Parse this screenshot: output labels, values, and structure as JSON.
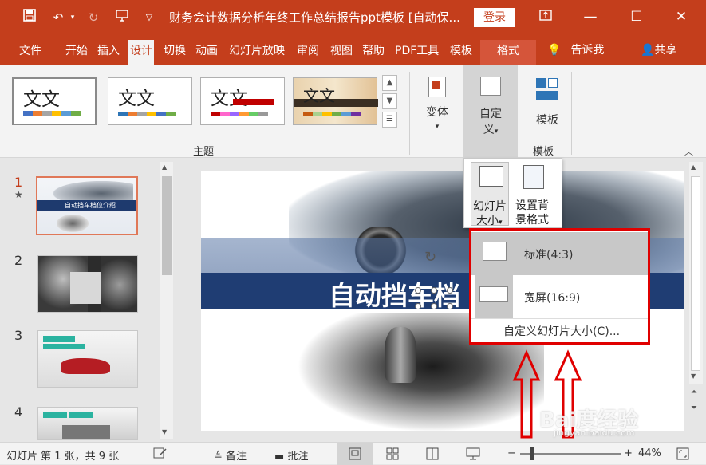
{
  "window": {
    "title": "财务会计数据分析年终工作总结报告ppt模板 [自动保...",
    "login_label": "登录"
  },
  "menu": {
    "items": [
      "文件",
      "开始",
      "插入",
      "设计",
      "切换",
      "动画",
      "幻灯片放映",
      "审阅",
      "视图",
      "帮助",
      "PDF工具",
      "模板"
    ],
    "active": "设计",
    "format_tab": "格式",
    "tell_me": "告诉我",
    "share": "共享"
  },
  "ribbon": {
    "themes": [
      {
        "text": "文文",
        "colors": [
          "#4472c4",
          "#ed7d31",
          "#a5a5a5",
          "#ffc000",
          "#5b9bd5",
          "#70ad47"
        ]
      },
      {
        "text": "文文",
        "colors": [
          "#2e75b6",
          "#ed7d31",
          "#a5a5a5",
          "#ffc000",
          "#4472c4",
          "#70ad47"
        ]
      },
      {
        "text": "文文",
        "colors": [
          "#c00000",
          "#ff66cc",
          "#9966ff",
          "#ff9933",
          "#66cc66",
          "#999999"
        ]
      },
      {
        "text": "文文",
        "colors": [
          "#c55a11",
          "#a9d18e",
          "#ffc000",
          "#70ad47",
          "#5b9bd5",
          "#7030a0"
        ]
      }
    ],
    "group_theme_label": "主题",
    "variant_label": "变体",
    "custom_label_1": "自定",
    "custom_label_2": "义",
    "template_btn_label": "模板",
    "group_template_label": "模板"
  },
  "dropdown": {
    "slide_size_1": "幻灯片",
    "slide_size_2": "大小",
    "bg_format_1": "设置背",
    "bg_format_2": "景格式",
    "options": [
      {
        "label": "标准(4:3)"
      },
      {
        "label": "宽屏(16:9)"
      }
    ],
    "custom_size": "自定义幻灯片大小(C)..."
  },
  "slides": {
    "numbers": [
      "1",
      "2",
      "3",
      "4"
    ],
    "star": "★",
    "thumb1_title": "自动挡车档位介绍",
    "main_title": "自动挡车档"
  },
  "status": {
    "slide_info": "幻灯片 第 1 张，共 9 张",
    "notes": "备注",
    "comments": "批注",
    "zoom": "44%"
  },
  "watermark": {
    "brand": "Bai度经验",
    "url": "jingyan.baidu.com"
  },
  "colors": {
    "accent": "#c43e1c",
    "highlight": "#e00000"
  }
}
